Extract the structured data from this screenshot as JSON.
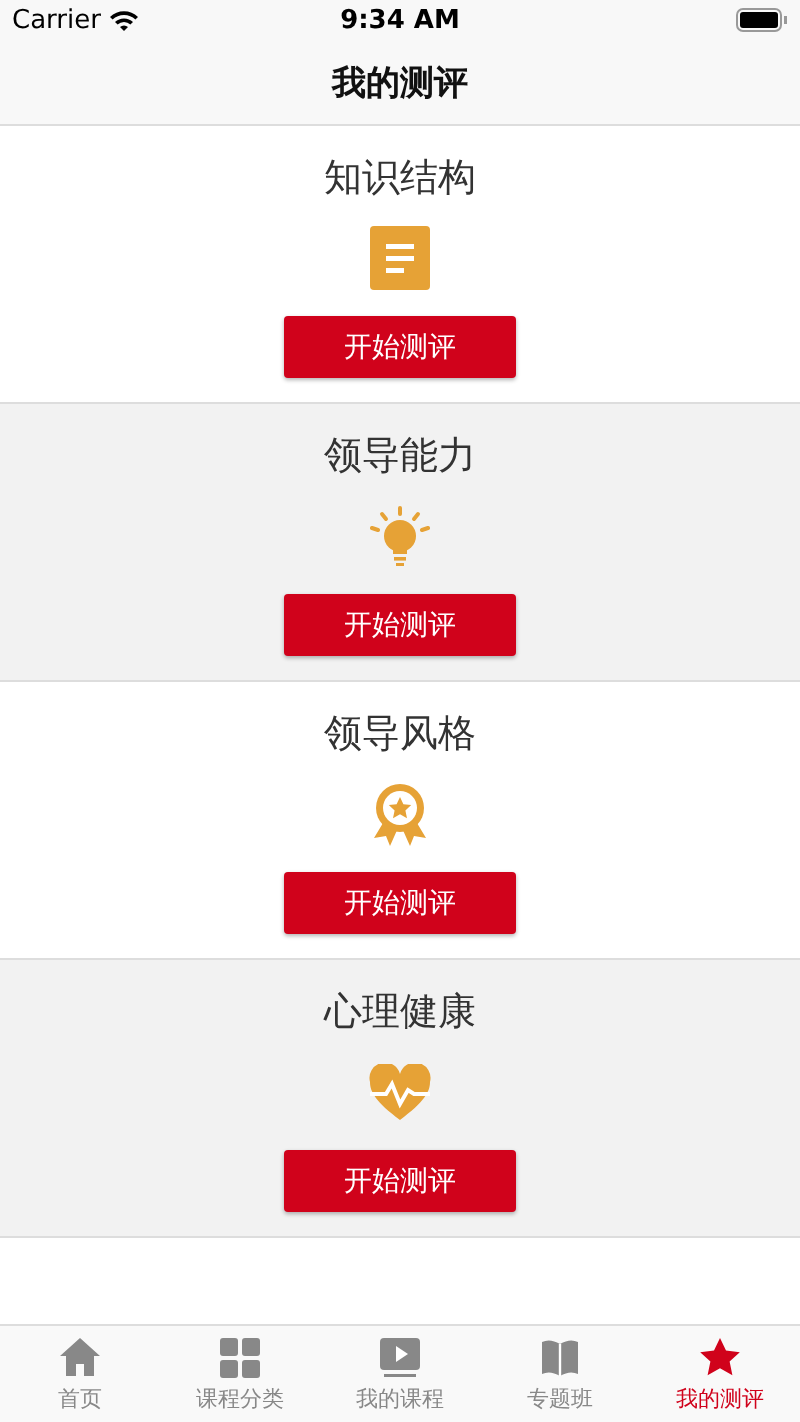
{
  "status_bar": {
    "carrier": "Carrier",
    "time": "9:34 AM"
  },
  "nav_bar": {
    "title": "我的测评"
  },
  "sections": [
    {
      "title": "知识结构",
      "kind": "document",
      "shaded": false,
      "button": "开始测评"
    },
    {
      "title": "领导能力",
      "kind": "bulb",
      "shaded": true,
      "button": "开始测评"
    },
    {
      "title": "领导风格",
      "kind": "badge",
      "shaded": false,
      "button": "开始测评"
    },
    {
      "title": "心理健康",
      "kind": "heart",
      "shaded": true,
      "button": "开始测评"
    }
  ],
  "tab_bar": [
    {
      "label": "首页",
      "kind": "home",
      "selected": false
    },
    {
      "label": "课程分类",
      "kind": "grid",
      "selected": false
    },
    {
      "label": "我的课程",
      "kind": "play",
      "selected": false
    },
    {
      "label": "专题班",
      "kind": "book",
      "selected": false
    },
    {
      "label": "我的测评",
      "kind": "star",
      "selected": true
    }
  ]
}
